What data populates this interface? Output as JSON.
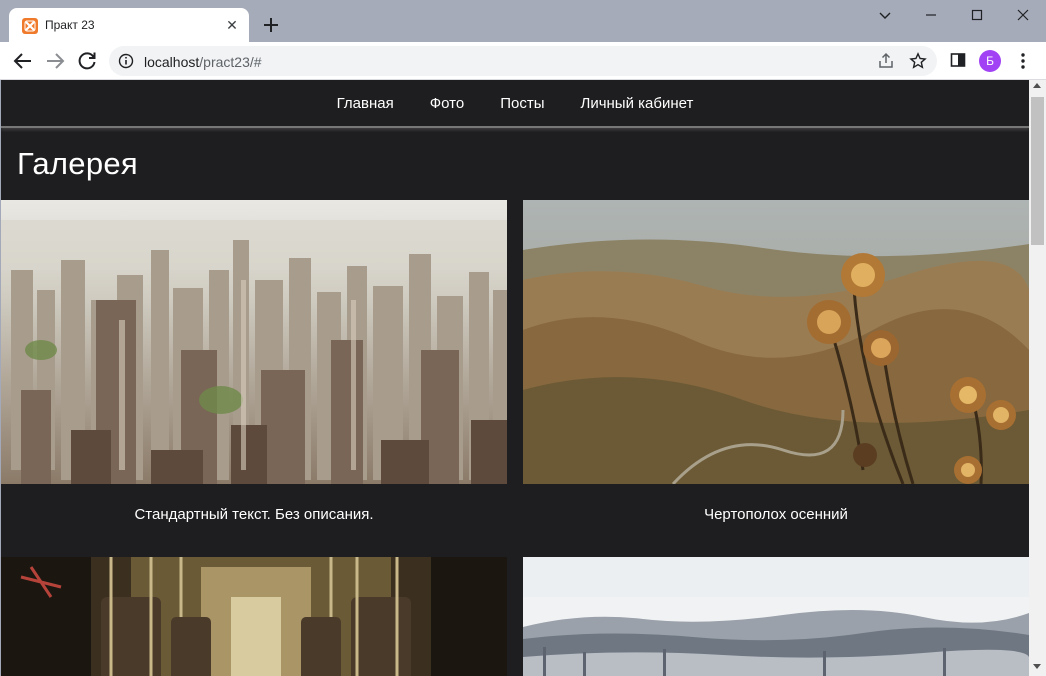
{
  "browser": {
    "tab_title": "Практ 23",
    "url_host": "localhost",
    "url_path": "/pract23/#",
    "profile_initial": "Б",
    "icons": [
      "xampp-favicon",
      "close-icon",
      "plus-icon",
      "chevron-down-icon",
      "minimize-icon",
      "maximize-icon",
      "window-close-icon",
      "back-arrow-icon",
      "forward-arrow-icon",
      "reload-icon",
      "info-icon",
      "share-icon",
      "star-icon",
      "side-panel-icon",
      "kebab-menu-icon"
    ]
  },
  "site": {
    "nav": [
      "Главная",
      "Фото",
      "Посты",
      "Личный кабинет"
    ],
    "title": "Галерея",
    "gallery": [
      {
        "caption": "Стандартный текст. Без описания."
      },
      {
        "caption": "Чертополох осенний"
      },
      {
        "caption": ""
      },
      {
        "caption": ""
      }
    ]
  },
  "colors": {
    "page_bg": "#1e1d1f",
    "avatar": "#a142f4",
    "favicon": "#f07a2b"
  }
}
